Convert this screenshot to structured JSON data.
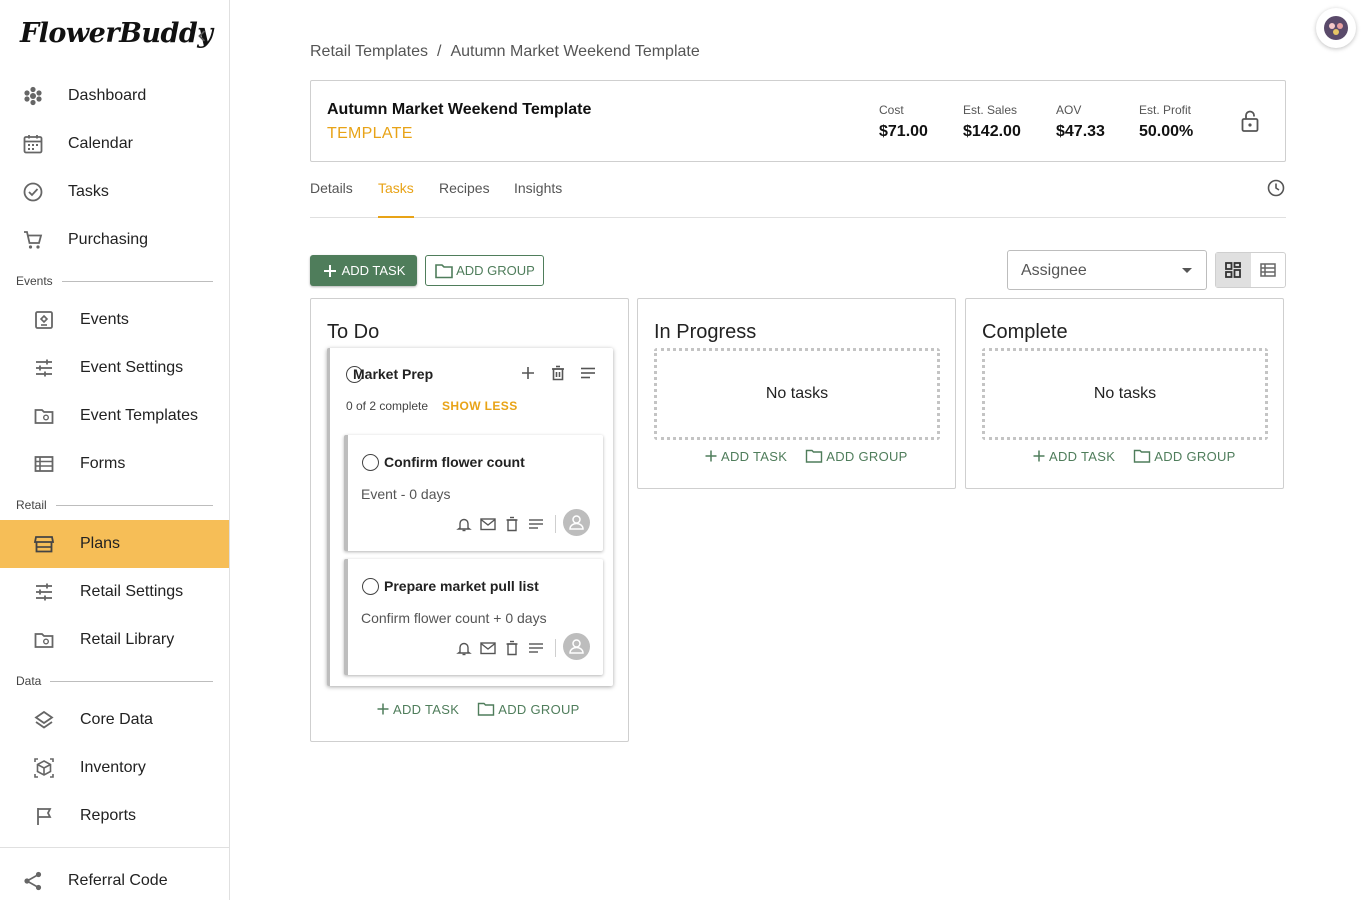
{
  "sidebar": {
    "logo": "FlowerBuddy",
    "items": [
      {
        "label": "Dashboard",
        "icon": "flower-icon"
      },
      {
        "label": "Calendar",
        "icon": "calendar-icon"
      },
      {
        "label": "Tasks",
        "icon": "check-circle-icon"
      },
      {
        "label": "Purchasing",
        "icon": "cart-icon"
      }
    ],
    "events_section": "Events",
    "events_items": [
      {
        "label": "Events",
        "icon": "event-icon"
      },
      {
        "label": "Event Settings",
        "icon": "sliders-icon"
      },
      {
        "label": "Event Templates",
        "icon": "folder-icon"
      },
      {
        "label": "Forms",
        "icon": "list-icon"
      }
    ],
    "retail_section": "Retail",
    "retail_items": [
      {
        "label": "Plans",
        "icon": "store-icon",
        "active": true
      },
      {
        "label": "Retail Settings",
        "icon": "sliders-icon"
      },
      {
        "label": "Retail Library",
        "icon": "folder-icon"
      }
    ],
    "data_section": "Data",
    "data_items": [
      {
        "label": "Core Data",
        "icon": "layers-icon"
      },
      {
        "label": "Inventory",
        "icon": "box-icon"
      },
      {
        "label": "Reports",
        "icon": "flag-icon"
      }
    ],
    "referral": {
      "label": "Referral Code",
      "icon": "share-icon"
    }
  },
  "breadcrumb": {
    "parent": "Retail Templates",
    "separator": "/",
    "current": "Autumn Market Weekend Template"
  },
  "summary": {
    "title": "Autumn Market Weekend Template",
    "subtitle": "TEMPLATE",
    "metrics": [
      {
        "label": "Cost",
        "value": "$71.00"
      },
      {
        "label": "Est. Sales",
        "value": "$142.00"
      },
      {
        "label": "AOV",
        "value": "$47.33"
      },
      {
        "label": "Est. Profit",
        "value": "50.00%"
      }
    ]
  },
  "tabs": [
    {
      "label": "Details"
    },
    {
      "label": "Tasks",
      "active": true
    },
    {
      "label": "Recipes"
    },
    {
      "label": "Insights"
    }
  ],
  "toolbar": {
    "add_task": "ADD TASK",
    "add_group": "ADD GROUP",
    "assignee_placeholder": "Assignee"
  },
  "columns": [
    {
      "title": "To Do",
      "group": {
        "title": "Market Prep",
        "progress": "0 of 2 complete",
        "toggle": "SHOW LESS",
        "tasks": [
          {
            "title": "Confirm flower count",
            "subtitle": "Event - 0 days"
          },
          {
            "title": "Prepare market pull list",
            "subtitle": "Confirm flower count + 0 days"
          }
        ]
      },
      "add_task": "ADD TASK",
      "add_group": "ADD GROUP"
    },
    {
      "title": "In Progress",
      "empty": "No tasks",
      "add_task": "ADD TASK",
      "add_group": "ADD GROUP"
    },
    {
      "title": "Complete",
      "empty": "No tasks",
      "add_task": "ADD TASK",
      "add_group": "ADD GROUP"
    }
  ],
  "colors": {
    "accent": "#f6be57",
    "accent_text": "#e8a317",
    "primary": "#4f7d5b"
  }
}
